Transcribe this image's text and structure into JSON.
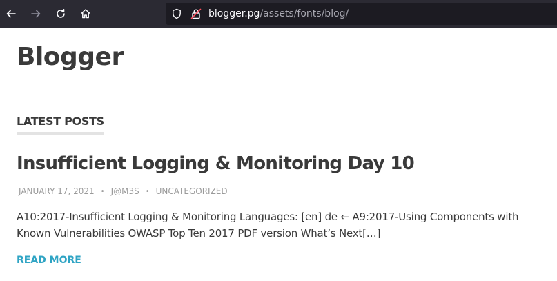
{
  "browser": {
    "url_host": "blogger.pg",
    "url_path": "/assets/fonts/blog/"
  },
  "site": {
    "title": "Blogger"
  },
  "section": {
    "label": "LATEST POSTS"
  },
  "post": {
    "title": "Insufficient Logging & Monitoring Day 10",
    "date": "JANUARY 17, 2021",
    "author": "J@M3S",
    "category": "UNCATEGORIZED",
    "separator": "•",
    "excerpt": "A10:2017-Insufficient Logging & Monitoring Languages: [en] de ← A9:2017-Using Components with Known Vulnerabilities OWASP Top Ten 2017 PDF version What’s Next[…]",
    "read_more": "READ MORE"
  },
  "colors": {
    "toolbar_bg": "#2b2a33",
    "urlbar_bg": "#1c1b22",
    "text": "#3a3a3a",
    "meta": "#9a9a9a",
    "link": "#2fa4c4"
  }
}
